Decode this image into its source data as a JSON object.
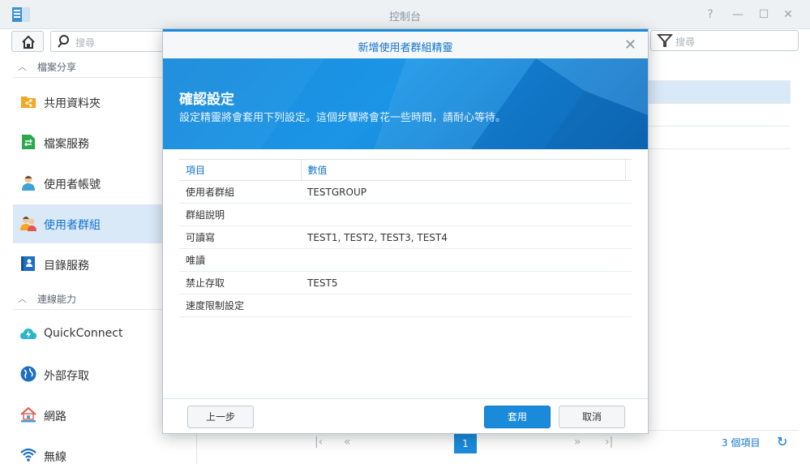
{
  "window": {
    "title": "控制台"
  },
  "toolbar": {
    "search_placeholder": "搜尋",
    "filter_placeholder": "搜尋"
  },
  "sidebar": {
    "sections": [
      {
        "label": "檔案分享"
      },
      {
        "label": "連線能力"
      }
    ],
    "items": [
      {
        "label": "共用資料夾",
        "icon": "folder-share-icon"
      },
      {
        "label": "檔案服務",
        "icon": "file-services-icon"
      },
      {
        "label": "使用者帳號",
        "icon": "user-icon"
      },
      {
        "label": "使用者群組",
        "icon": "user-group-icon",
        "active": true
      },
      {
        "label": "目錄服務",
        "icon": "directory-icon"
      },
      {
        "label": "QuickConnect",
        "icon": "cloud-icon"
      },
      {
        "label": "外部存取",
        "icon": "globe-icon"
      },
      {
        "label": "網路",
        "icon": "network-icon"
      },
      {
        "label": "無線",
        "icon": "wifi-icon"
      }
    ]
  },
  "pager": {
    "current": "1",
    "count": "3 個項目"
  },
  "modal": {
    "title": "新增使用者群組精靈",
    "heading": "確認設定",
    "subtitle": "設定精靈將會套用下列設定。這個步驟將會花一些時間，請耐心等待。",
    "columns": [
      "項目",
      "數值"
    ],
    "rows": [
      {
        "item": "使用者群組",
        "value": "TESTGROUP"
      },
      {
        "item": "群組說明",
        "value": ""
      },
      {
        "item": "可讀寫",
        "value": "TEST1, TEST2, TEST3, TEST4"
      },
      {
        "item": "唯讀",
        "value": ""
      },
      {
        "item": "禁止存取",
        "value": "TEST5"
      },
      {
        "item": "速度限制設定",
        "value": ""
      }
    ],
    "buttons": {
      "back": "上一步",
      "apply": "套用",
      "cancel": "取消"
    }
  },
  "colors": {
    "accent": "#1a8bdb",
    "active_bg": "#dae9f8"
  }
}
